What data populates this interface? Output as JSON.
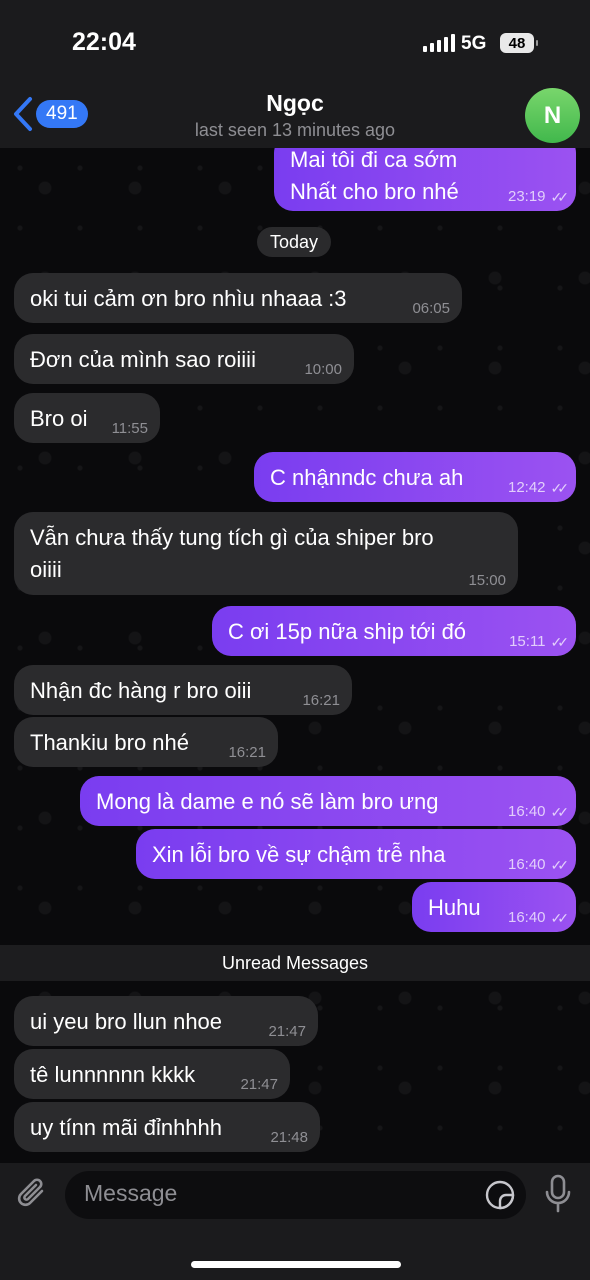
{
  "status_bar": {
    "time": "22:04",
    "network": "5G",
    "battery": "48"
  },
  "header": {
    "back_count": "491",
    "contact_name": "Ngọc",
    "last_seen": "last seen 13 minutes ago",
    "avatar_letter": "N",
    "avatar_color": "#5cc55a"
  },
  "date_pill": "Today",
  "unread_divider": "Unread Messages",
  "messages": [
    {
      "dir": "out",
      "lines": [
        "Mai tôi đi ca sớm",
        "Nhất cho bro nhé"
      ],
      "time": "23:19",
      "read": true
    },
    {
      "dir": "in",
      "lines": [
        "oki tui cảm ơn bro nhìu nhaaa :3"
      ],
      "time": "06:05"
    },
    {
      "dir": "in",
      "lines": [
        "Đơn của mình sao roiiii"
      ],
      "time": "10:00"
    },
    {
      "dir": "in",
      "lines": [
        "Bro oi"
      ],
      "time": "11:55"
    },
    {
      "dir": "out",
      "lines": [
        "C nhậnndc chưa ah"
      ],
      "time": "12:42",
      "read": true
    },
    {
      "dir": "in",
      "lines": [
        "Vẫn chưa thấy tung tích gì của shiper bro",
        "oiiii"
      ],
      "time": "15:00"
    },
    {
      "dir": "out",
      "lines": [
        "C ơi 15p nữa ship tới đó"
      ],
      "time": "15:11",
      "read": true
    },
    {
      "dir": "in",
      "lines": [
        "Nhận đc hàng r bro oiii"
      ],
      "time": "16:21"
    },
    {
      "dir": "in",
      "lines": [
        "Thankiu bro nhé"
      ],
      "time": "16:21"
    },
    {
      "dir": "out",
      "lines": [
        "Mong là dame e nó sẽ làm bro ưng"
      ],
      "time": "16:40",
      "read": true
    },
    {
      "dir": "out",
      "lines": [
        "Xin lỗi bro về sự chậm trễ nha"
      ],
      "time": "16:40",
      "read": true
    },
    {
      "dir": "out",
      "lines": [
        "Huhu"
      ],
      "time": "16:40",
      "read": true
    },
    {
      "dir": "in",
      "lines": [
        "ui yeu bro llun nhoe"
      ],
      "time": "21:47"
    },
    {
      "dir": "in",
      "lines": [
        "tê lunnnnnn kkkk"
      ],
      "time": "21:47"
    },
    {
      "dir": "in",
      "lines": [
        "uy tínn mãi đỉnhhhh"
      ],
      "time": "21:48"
    }
  ],
  "input": {
    "placeholder": "Message"
  },
  "colors": {
    "outgoing": "#8a48f1",
    "incoming": "#2b2b2d",
    "accent": "#3478f6"
  }
}
